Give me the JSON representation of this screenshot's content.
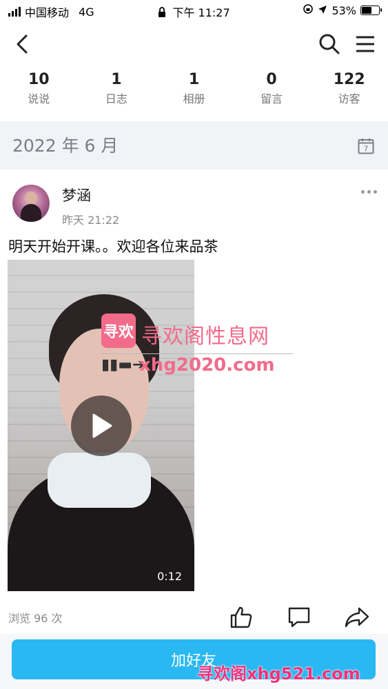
{
  "status_bar": {
    "carrier": "中国移动",
    "network": "4G",
    "time": "下午 11:27",
    "battery": "53%",
    "battery_level": 0.53
  },
  "nav": {
    "back_icon": "chevron-left-icon",
    "search_icon": "search-icon",
    "menu_icon": "menu-icon"
  },
  "stats": [
    {
      "value": "10",
      "label": "说说"
    },
    {
      "value": "1",
      "label": "日志"
    },
    {
      "value": "1",
      "label": "相册"
    },
    {
      "value": "0",
      "label": "留言"
    },
    {
      "value": "122",
      "label": "访客"
    }
  ],
  "month_bar": {
    "label": "2022 年 6 月",
    "calendar_day": "7"
  },
  "post": {
    "author": "梦涵",
    "time": "昨天 21:22",
    "text": "明天开始开课。。欢迎各位来品茶",
    "video_duration": "0:12",
    "views": "浏览 96 次"
  },
  "watermark": {
    "logo_text": "寻欢",
    "title": "寻欢阁性息网",
    "url": "xhg2020.com",
    "arrow": "▮▮▬➔"
  },
  "footer": {
    "button_label": "加好友",
    "watermark": "寻欢阁xhg521.com"
  },
  "colors": {
    "accent": "#2ab8f2",
    "watermark_pink": "#f26b8a",
    "month_bg": "#f2f3f7"
  }
}
